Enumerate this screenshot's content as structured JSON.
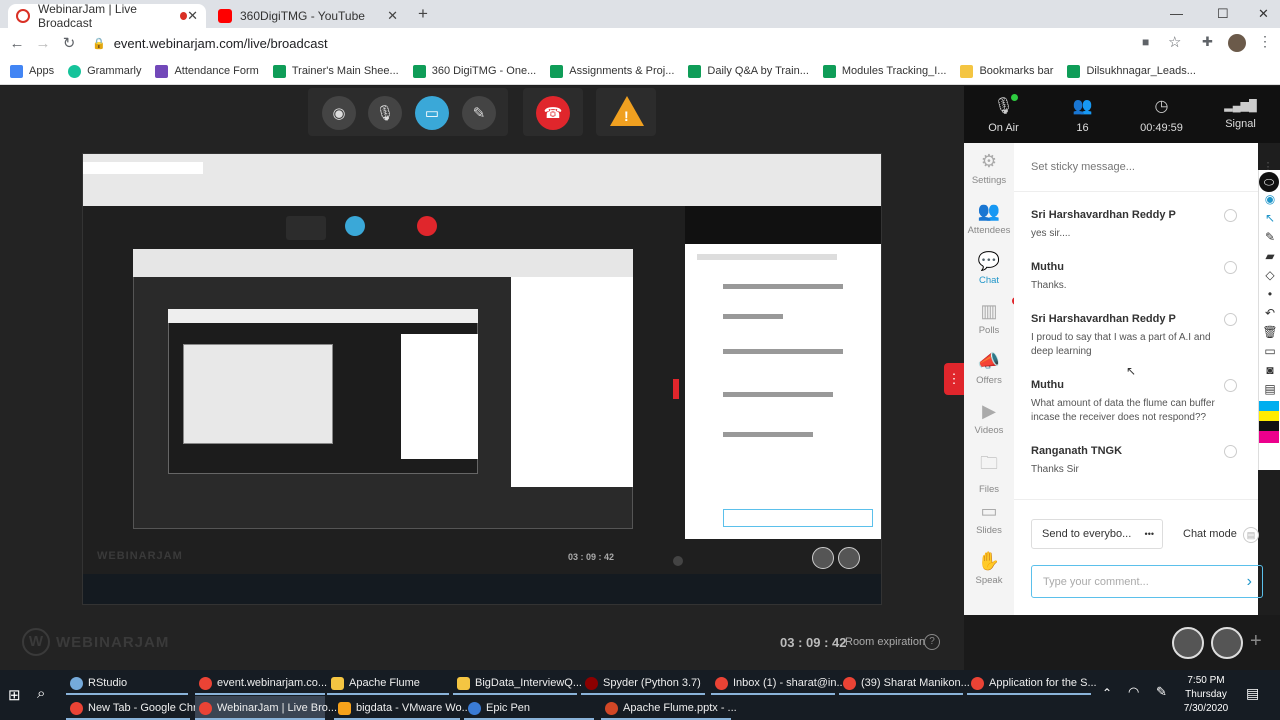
{
  "browser": {
    "tabs": [
      {
        "label": "WebinarJam | Live Broadcast",
        "color": "#d93025"
      },
      {
        "label": "360DigiTMG - YouTube",
        "color": "#ff0000"
      }
    ],
    "new_tab": "+",
    "url": "event.webinarjam.com/live/broadcast",
    "bookmarks": [
      {
        "label": "Apps",
        "color": "#ea4335"
      },
      {
        "label": "Grammarly",
        "color": "#15c39a"
      },
      {
        "label": "Attendance Form",
        "color": "#7248b9"
      },
      {
        "label": "Trainer's Main Shee...",
        "color": "#0f9d58"
      },
      {
        "label": "360 DigiTMG - One...",
        "color": "#0f9d58"
      },
      {
        "label": "Assignments & Proj...",
        "color": "#0f9d58"
      },
      {
        "label": "Daily Q&A by Train...",
        "color": "#0f9d58"
      },
      {
        "label": "Modules Tracking_I...",
        "color": "#0f9d58"
      },
      {
        "label": "Bookmarks bar",
        "color": "#f4c542"
      },
      {
        "label": "Dilsukhnagar_Leads...",
        "color": "#0f9d58"
      }
    ]
  },
  "stats": [
    {
      "icon": "mic-icon",
      "glyph": "🎙",
      "label": "On Air"
    },
    {
      "icon": "attendees-icon",
      "glyph": "👥",
      "label": "16"
    },
    {
      "icon": "clock-icon",
      "glyph": "◷",
      "label": "00:49:59"
    },
    {
      "icon": "signal-icon",
      "glyph": "▂▄▆█",
      "label": "Signal"
    }
  ],
  "controls": {
    "colors": {
      "camera": "#444",
      "mic": "#444",
      "screen": "#3aa8d8",
      "pen": "#444",
      "hangup": "#e0262c",
      "warning": "#f0a020"
    }
  },
  "sidenav": [
    {
      "label": "Settings",
      "glyph": "⚙"
    },
    {
      "label": "Attendees",
      "glyph": "👥"
    },
    {
      "label": "Chat",
      "glyph": "💬",
      "selected": true
    },
    {
      "label": "Polls",
      "glyph": "▥"
    },
    {
      "label": "Offers",
      "glyph": "📣"
    },
    {
      "label": "Videos",
      "glyph": "▶"
    },
    {
      "label": "Files",
      "glyph": "🗀"
    },
    {
      "label": "Slides",
      "glyph": "▭"
    },
    {
      "label": "Speak",
      "glyph": "✋"
    }
  ],
  "chat": {
    "sticky_placeholder": "Set sticky message...",
    "messages": [
      {
        "name": "Sri Harshavardhan Reddy P",
        "text": "yes sir...."
      },
      {
        "name": "Muthu",
        "text": "Thanks."
      },
      {
        "name": "Sri Harshavardhan Reddy P",
        "text": "I proud to say that I was a part of A.I and deep learning"
      },
      {
        "name": "Muthu",
        "text": "What amount of data the flume can buffer incase the receiver does not respond??"
      },
      {
        "name": "Ranganath TNGK",
        "text": "Thanks Sir"
      }
    ],
    "send_to": "Send to everybo...",
    "send_more": "•••",
    "chat_mode": "Chat mode",
    "comment_placeholder": "Type your comment..."
  },
  "stage": {
    "brand": "WEBINARJAM",
    "timer": "03 : 09 : 42",
    "expiration": "Room expiration"
  },
  "taskbar": {
    "row1": [
      {
        "label": "RStudio",
        "color": "#75aadb"
      },
      {
        "label": "event.webinarjam.co...",
        "color": "#ea4335"
      },
      {
        "label": "Apache Flume",
        "color": "#f4c542"
      },
      {
        "label": "BigData_InterviewQ...",
        "color": "#f4c542"
      },
      {
        "label": "Spyder (Python 3.7)",
        "color": "#8c0000"
      },
      {
        "label": "Inbox (1) - sharat@in...",
        "color": "#ea4335"
      },
      {
        "label": "(39) Sharat Manikon...",
        "color": "#ea4335"
      },
      {
        "label": "Application for the S...",
        "color": "#ea4335"
      }
    ],
    "row2": [
      {
        "label": "New Tab - Google Chr...",
        "color": "#ea4335"
      },
      {
        "label": "WebinarJam | Live Bro...",
        "color": "#ea4335"
      },
      {
        "label": "bigdata - VMware Wo...",
        "color": "#f7a21b"
      },
      {
        "label": "Epic Pen",
        "color": "#3a7bd5"
      },
      {
        "label": "Apache Flume.pptx - ...",
        "color": "#d24726"
      }
    ],
    "time": "7:50 PM",
    "day": "Thursday",
    "date": "7/30/2020"
  }
}
